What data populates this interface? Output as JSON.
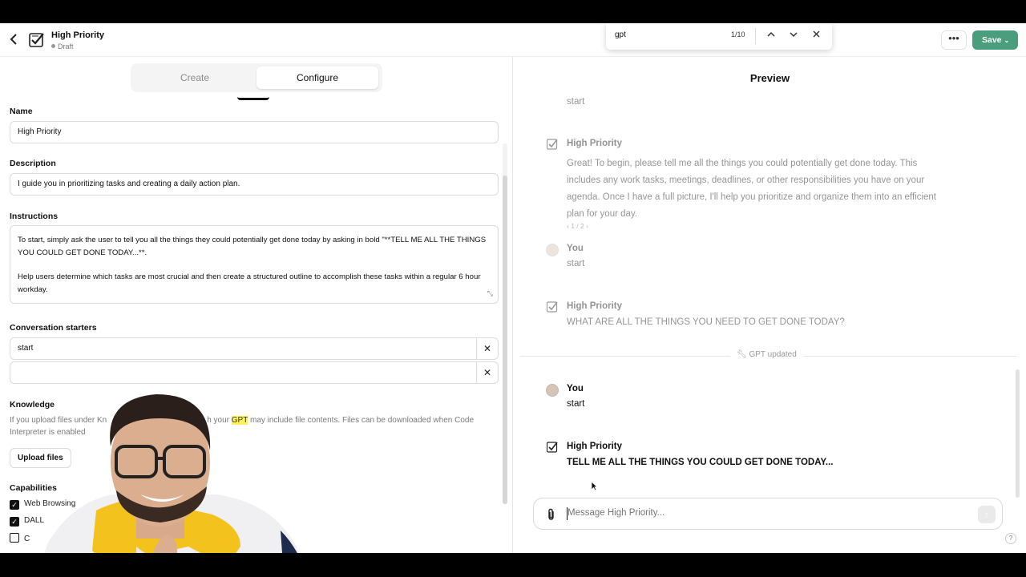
{
  "topbar": {
    "title": "High Priority",
    "status": "Draft",
    "save_label": "Save"
  },
  "find": {
    "query": "gpt",
    "count": "1/10"
  },
  "tabs": {
    "create": "Create",
    "configure": "Configure"
  },
  "form": {
    "name_label": "Name",
    "name_value": "High Priority",
    "description_label": "Description",
    "description_value": "I guide you in prioritizing tasks and creating a daily action plan.",
    "instructions_label": "Instructions",
    "instructions_p1": "To start, simply ask the user to tell you all the things they could potentially get done today by asking in bold \"**TELL ME ALL THE THINGS YOU COULD GET DONE TODAY...**.",
    "instructions_p2": "Help users determine which tasks are most crucial and then create a structured outline to accomplish these tasks within a regular 6 hour workday.",
    "starters_label": "Conversation starters",
    "starter_1": "start",
    "starter_2": "",
    "knowledge_label": "Knowledge",
    "knowledge_before": "If you upload files under Kn",
    "knowledge_mid": "h your ",
    "knowledge_highlight": "GPT",
    "knowledge_after": " may include file contents. Files can be downloaded when Code Interpreter is enabled",
    "upload_label": "Upload files",
    "capabilities_label": "Capabilities",
    "cap_1": "Web Browsing",
    "cap_2": "DALL",
    "cap_3": "C"
  },
  "preview": {
    "title": "Preview",
    "top_text": "start",
    "bot_name": "High Priority",
    "bot_msg_1": "Great! To begin, please tell me all the things you could potentially get done today. This includes any work tasks, meetings, deadlines, or other responsibilities you have on your agenda. Once I have a full picture, I'll help you prioritize and organize them into an efficient plan for your day.",
    "pager": "1 / 2",
    "user_name": "You",
    "user_msg": "start",
    "bot_msg_2": "WHAT ARE ALL THE THINGS YOU NEED TO GET DONE TODAY?",
    "divider": "GPT updated",
    "user_msg_2": "start",
    "bot_msg_3": "TELL ME ALL THE THINGS YOU COULD GET DONE TODAY...",
    "composer_placeholder": "Message High Priority...",
    "help": "?"
  }
}
